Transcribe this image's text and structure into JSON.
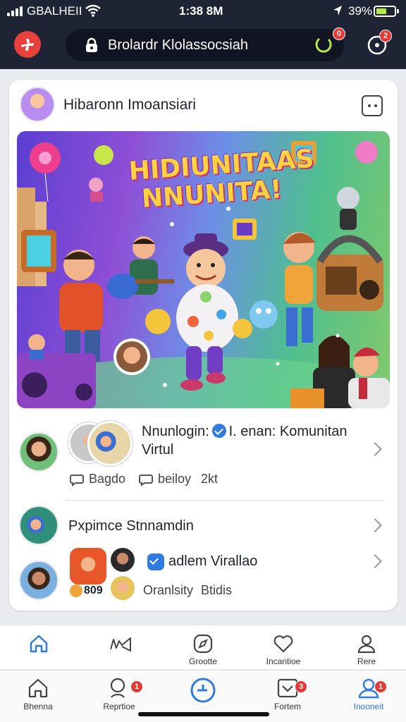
{
  "status_bar": {
    "carrier": "GBALHEII",
    "time": "1:38 8M",
    "battery": "39%"
  },
  "header": {
    "search_text": "Brolardr Klolassocsiah",
    "ring_badge": "0",
    "notifications_badge": "2"
  },
  "post": {
    "title": "Hibaronn Imoansiari",
    "hero_headline_1": "HIDIUNITAAS",
    "hero_headline_2": "NNUNITA!"
  },
  "feed": {
    "row1": {
      "title_line1": "Nnunlogin:",
      "title_line1_rest": "I. enan: Komunitan",
      "title_line2": "Virtul",
      "action1": "Bagdo",
      "action2": "beiloy",
      "count": "2kt"
    },
    "row2": {
      "title": "Pxpimce Stnnamdin"
    },
    "row3": {
      "title": "adlem Virallao",
      "badge_text": "809",
      "meta1": "Oranlsity",
      "meta2": "Btidis"
    }
  },
  "nav_top": [
    {
      "label": "",
      "icon": "home-outline-icon"
    },
    {
      "label": "",
      "icon": "megaphone-icon"
    },
    {
      "label": "Grootte",
      "icon": "compass-icon"
    },
    {
      "label": "Incantioe",
      "icon": "heart-icon"
    },
    {
      "label": "Rere",
      "icon": "person-icon"
    }
  ],
  "nav_bottom": [
    {
      "label": "Bhenna",
      "icon": "home-icon",
      "badge": ""
    },
    {
      "label": "Reprtioe",
      "icon": "search-user-icon",
      "badge": "1"
    },
    {
      "label": "",
      "icon": "add-circle-icon",
      "badge": ""
    },
    {
      "label": "Fortem",
      "icon": "inbox-icon",
      "badge": "3"
    },
    {
      "label": "Inooneit",
      "icon": "profile-icon",
      "badge": "1"
    }
  ],
  "colors": {
    "accent": "#2f7be0",
    "brand": "#e8413b",
    "header_bg": "#1e2433",
    "badge": "#e53935"
  }
}
